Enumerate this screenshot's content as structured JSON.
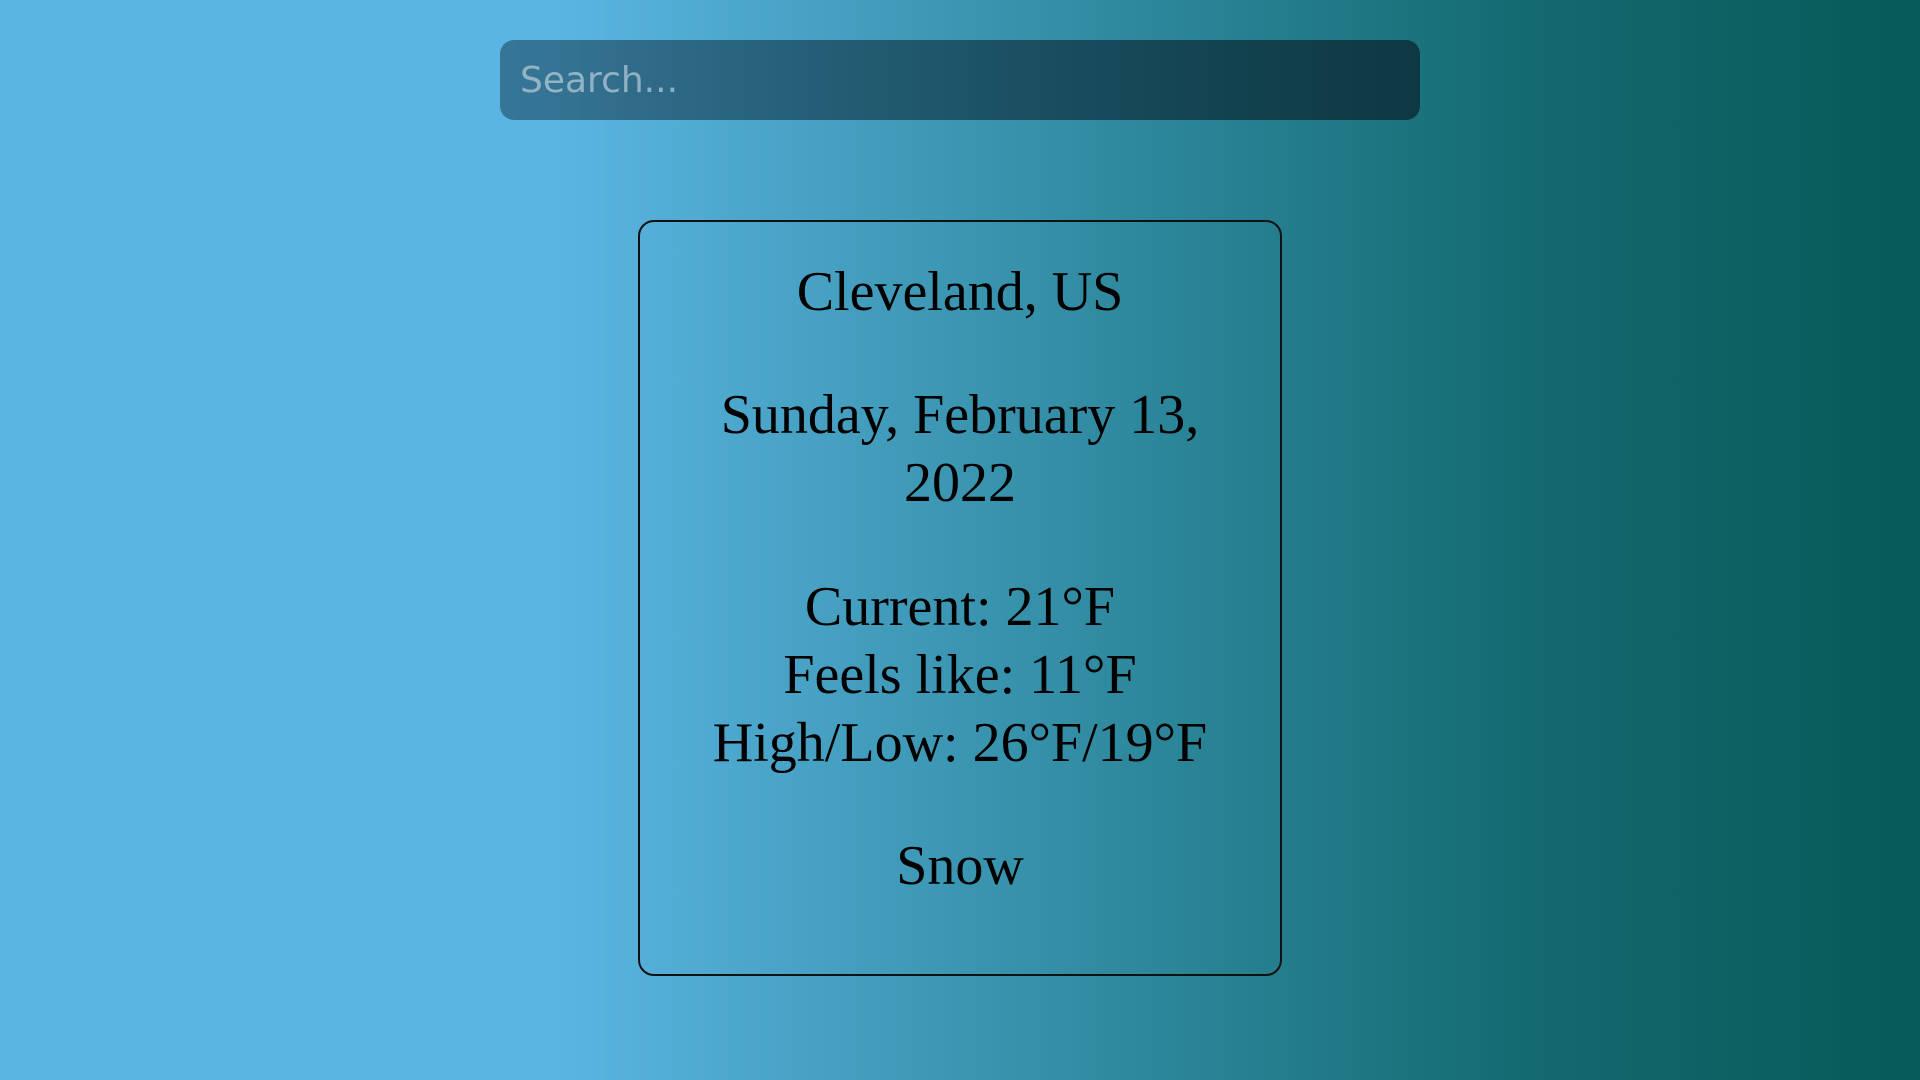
{
  "search": {
    "placeholder": "Search...",
    "value": ""
  },
  "weather": {
    "location": "Cleveland, US",
    "date": "Sunday, February 13, 2022",
    "current": "Current: 21°F",
    "feels_like": "Feels like: 11°F",
    "high_low": "High/Low: 26°F/19°F",
    "condition": "Snow"
  },
  "colors": {
    "background_left": "#5bb5e2",
    "background_right": "#065a58",
    "text": "#000000"
  }
}
